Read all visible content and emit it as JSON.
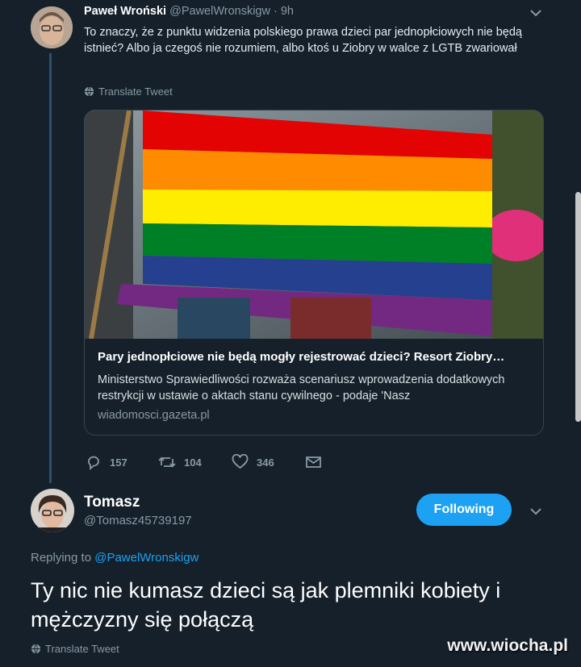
{
  "first_tweet": {
    "name": "Paweł Wroński",
    "handle_time": "@PawelWronskigw · 9h",
    "text": "To znaczy, że z punktu widzenia polskiego prawa dzieci par jednopłciowych nie będą istnieć? Albo ja czegoś nie rozumiem, albo ktoś u Ziobry w walce z LGTB zwariował",
    "translate": "Translate Tweet",
    "card": {
      "title": "Pary jednopłciowe nie będą mogły rejestrować dzieci? Resort Ziobry…",
      "description": "Ministerstwo Sprawiedliwości rozważa scenariusz wprowadzenia dodatkowych restrykcji w ustawie o aktach stanu cywilnego - podaje 'Nasz",
      "domain": "wiadomosci.gazeta.pl"
    },
    "actions": {
      "replies": "157",
      "retweets": "104",
      "likes": "346"
    }
  },
  "reply": {
    "name": "Tomasz",
    "handle": "@Tomasz45739197",
    "follow_label": "Following",
    "replying_prefix": "Replying to",
    "replying_handle": "@PawelWronskigw",
    "text": "Ty nic nie kumasz dzieci są jak plemniki kobiety i mężczyzny się połączą",
    "translate": "Translate Tweet"
  },
  "watermark": "www.wiocha.pl",
  "colors": {
    "background": "#15202b",
    "accent": "#1da1f2",
    "muted": "#8899a6",
    "border": "#38444d",
    "flag": [
      "#e40303",
      "#ff8c00",
      "#ffed00",
      "#008026",
      "#24408e",
      "#732982"
    ]
  },
  "icons": [
    "chevron-down-icon",
    "globe-icon",
    "reply-icon",
    "retweet-icon",
    "like-icon",
    "share-icon"
  ]
}
